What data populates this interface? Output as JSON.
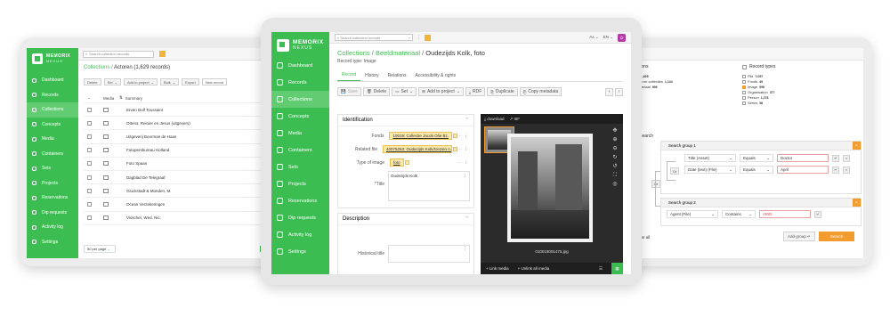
{
  "colors": {
    "brand_green": "#3cbd52",
    "accent_orange": "#f29b2f",
    "accent_purple": "#b23ba8",
    "tag_yellow": "#fbe7a8"
  },
  "brand": {
    "name": "MEMORIX",
    "sub": "NEXUS"
  },
  "left": {
    "search_placeholder": "Search collection records",
    "breadcrumb_root": "Collections",
    "breadcrumb_current": "Actoren (1,629 records)",
    "toolbar": [
      "Delete",
      "Set",
      "Add to project",
      "Bulk",
      "Export",
      "New record"
    ],
    "table_headers": [
      "Media",
      "Summary"
    ],
    "rows": [
      "Erven Dolf Toussaint",
      "Ottens, Reinier en Jesus (uitgevers)",
      "Uitgeverij Boorman de Haas",
      "Fotopersbureau Holland",
      "Foto Spaan",
      "Dagblad De Telegraaf",
      "Gluckstadt & Münden, M.",
      "Ocean Verzekeringen",
      "Visscher, Wed. Nic."
    ],
    "per_page": "50 per page",
    "nav": [
      "Dashboard",
      "Records",
      "Collections",
      "Concepts",
      "Media",
      "Containers",
      "Sets",
      "Projects",
      "Reservations",
      "Dip requests",
      "Activity log",
      "Settings"
    ],
    "active_nav": "Collections"
  },
  "center": {
    "search_placeholder": "Search collection records",
    "lang": "EN",
    "user_initials": "A",
    "breadcrumb_root": "Collections",
    "breadcrumb_mid": "Beeldmateriaal",
    "breadcrumb_current": "Oudezijds Kolk, foto",
    "record_type": "Record type: Image",
    "tabs": [
      "Record",
      "History",
      "Relations",
      "Accessibility & rights"
    ],
    "toolbar": [
      "Save",
      "Delete",
      "Set",
      "Add to project",
      "RDF",
      "Duplicate",
      "Copy metadata"
    ],
    "nav": [
      "Dashboard",
      "Records",
      "Collections",
      "Concepts",
      "Media",
      "Containers",
      "Sets",
      "Projects",
      "Reservations",
      "Dip requests",
      "Activity log",
      "Settings"
    ],
    "active_nav": "Collections",
    "identification": {
      "title": "Identification",
      "fields": [
        {
          "label": "Fonds",
          "value": "10019: Collectie Jacob Olie Bz."
        },
        {
          "label": "Related file",
          "value": "40075253: Oudezijds Kolk/Gezien n..."
        },
        {
          "label": "Type of image",
          "value": "foto"
        },
        {
          "label": "*Title",
          "value": "Oudezijds Kolk"
        }
      ]
    },
    "description": {
      "title": "Description",
      "field": "Historical title"
    },
    "viewer": {
      "download": "download",
      "iiif": "IIIF",
      "filename": "010019001475.jpg",
      "link_media": "Link media",
      "unlink_media": "Unlink all media"
    }
  },
  "right": {
    "collections_header": "Collections",
    "record_types_header": "Record types",
    "collections": [
      {
        "name": "Actoren",
        "count": "1,629"
      },
      {
        "name": "Archieven en collecties",
        "count": "1,144"
      },
      {
        "name": "Beeldmateriaal",
        "count": "996"
      }
    ],
    "record_types": [
      {
        "name": "File",
        "count": "7,097",
        "checked": false
      },
      {
        "name": "Fonds",
        "count": "49",
        "checked": false
      },
      {
        "name": "Image",
        "count": "996",
        "checked": true
      },
      {
        "name": "Organisation",
        "count": "377",
        "checked": false
      },
      {
        "name": "Person",
        "count": "1,278",
        "checked": false
      },
      {
        "name": "Series",
        "count": "56",
        "checked": false
      }
    ],
    "advanced_search": "anced search",
    "group1": {
      "title": "Search group 1",
      "or_label": "Or",
      "rows": [
        {
          "field": "Title (Asset)",
          "op": "Equals",
          "value": "Doctor"
        },
        {
          "field": "Date (text) (File)",
          "op": "Equals",
          "value": "April"
        }
      ]
    },
    "outer_or": "Or",
    "group2": {
      "title": "Search group 2",
      "rows": [
        {
          "field": "Agent (File)",
          "op": "Contains",
          "value": "AMO"
        }
      ]
    },
    "clear_all": "ear all",
    "add_group": "Add group",
    "search_btn": "Search"
  }
}
